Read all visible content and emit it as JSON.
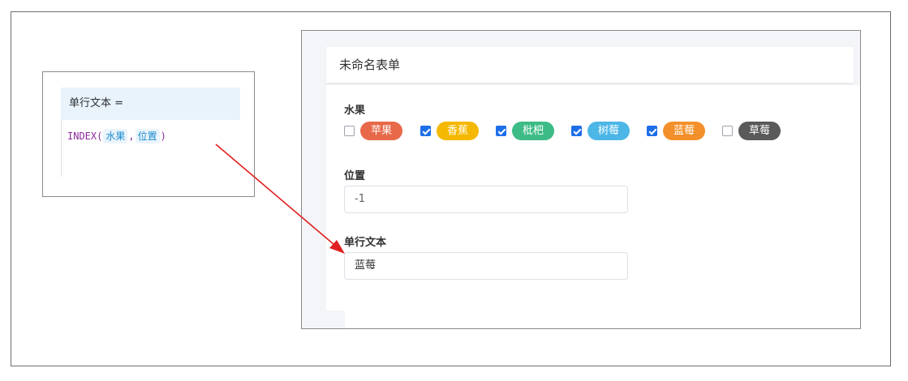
{
  "formula": {
    "header": "单行文本 =",
    "func": "INDEX(",
    "arg1": "水果",
    "comma": ",",
    "arg2": "位置",
    "close": ")"
  },
  "form": {
    "title": "未命名表单",
    "fruit_label": "水果",
    "fruit_options": [
      {
        "label": "苹果",
        "checked": false,
        "color": "#e8694a"
      },
      {
        "label": "香蕉",
        "checked": true,
        "color": "#f5b800"
      },
      {
        "label": "枇杷",
        "checked": true,
        "color": "#3dbb87"
      },
      {
        "label": "树莓",
        "checked": true,
        "color": "#4cb6e6"
      },
      {
        "label": "蓝莓",
        "checked": true,
        "color": "#f3902b"
      },
      {
        "label": "草莓",
        "checked": false,
        "color": "#5a5a5a"
      }
    ],
    "position_label": "位置",
    "position_value": "-1",
    "text_label": "单行文本",
    "text_value": "蓝莓"
  },
  "colors": {
    "arrow": "#e02020",
    "check_blue": "#1e6ee8"
  }
}
